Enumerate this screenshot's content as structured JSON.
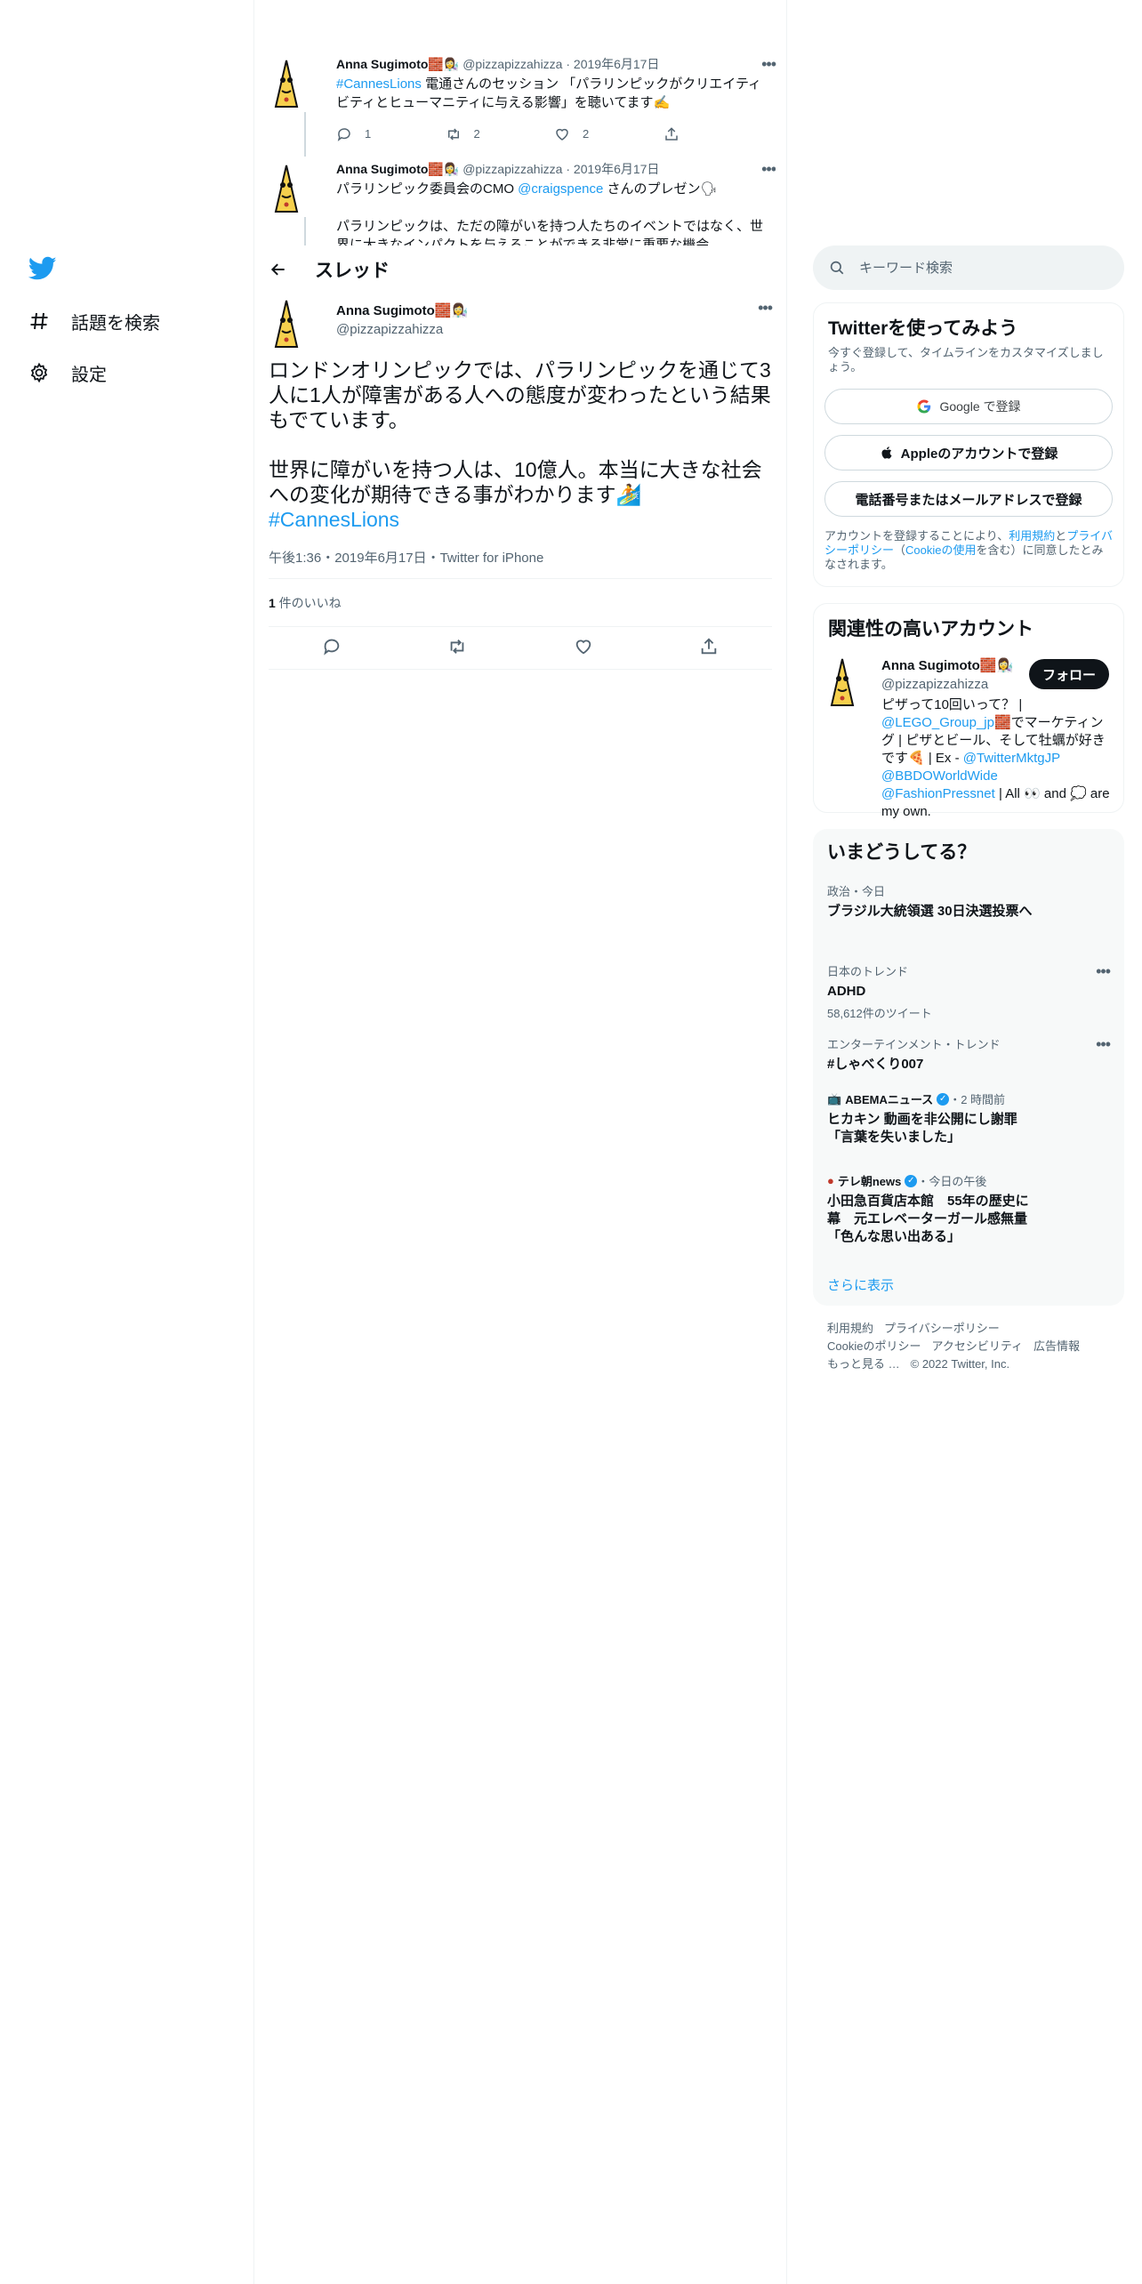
{
  "nav": {
    "explore": "話題を検索",
    "settings": "設定"
  },
  "header": {
    "title": "スレッド"
  },
  "context_tweets": [
    {
      "name": "Anna Sugimoto🧱👩‍🔬",
      "handle": "@pizzapizzahizza",
      "date": "2019年6月17日",
      "hashtag": "#CannesLions",
      "text": " 電通さんのセッション 「パラリンピックがクリエイティビティとヒューマニティに与える影響」を聴いてます✍️",
      "replies": "1",
      "retweets": "2",
      "likes": "2"
    },
    {
      "name": "Anna Sugimoto🧱👩‍🔬",
      "handle": "@pizzapizzahizza",
      "date": "2019年6月17日",
      "text_pre": "パラリンピック委員会のCMO ",
      "mention": "@craigspence",
      "text_post": " さんのプレゼン🗣",
      "text2": "パラリンピックは、ただの障がいを持つ人たちのイベントではなく、世界に大きなインパクトを与えることができる非常に重要な機会。"
    }
  ],
  "focus": {
    "name": "Anna Sugimoto🧱👩‍🔬",
    "handle": "@pizzapizzahizza",
    "text": "ロンドンオリンピックでは、パラリンピックを通じて3人に1人が障害がある人への態度が変わったという結果もでています。\n\n世界に障がいを持つ人は、10億人。本当に大きな社会への変化が期待できる事がわかります🏄",
    "hashtag": "#CannesLions",
    "meta": "午後1:36・2019年6月17日・Twitter for iPhone",
    "likes_count": "1",
    "likes_label": " 件のいいね"
  },
  "search": {
    "placeholder": "キーワード検索"
  },
  "signup": {
    "title": "Twitterを使ってみよう",
    "subtitle": "今すぐ登録して、タイムラインをカスタマイズしましょう。",
    "google": "Google で登録",
    "apple": "Appleのアカウントで登録",
    "phone": "電話番号またはメールアドレスで登録",
    "terms_1": "アカウントを登録することにより、",
    "terms_link1": "利用規約",
    "terms_2": "と",
    "terms_link2": "プライバシーポリシー",
    "terms_3": "（",
    "terms_link3": "Cookieの使用",
    "terms_4": "を含む）に同意したとみなされます。"
  },
  "related": {
    "title": "関連性の高いアカウント",
    "name": "Anna Sugimoto🧱👩‍🔬",
    "handle": "@pizzapizzahizza",
    "follow": "フォロー",
    "bio_1": "ピザって10回いって？ | ",
    "bio_link1": "@LEGO_Group_jp",
    "bio_2": "🧱でマーケティング | ピザとビール、そして牡蠣が好きです🍕 | Ex - ",
    "bio_link2": "@TwitterMktgJP",
    "bio_link3": "@BBDOWorldWide",
    "bio_link4": "@FashionPressnet",
    "bio_3": " | All 👀 and 💭 are my own."
  },
  "trends": {
    "title": "いまどうしてる？",
    "items": [
      {
        "context": "政治・今日",
        "title": "ブラジル大統領選 30日決選投票へ"
      },
      {
        "context": "日本のトレンド",
        "title": "ADHD",
        "count": "58,612件のツイート"
      },
      {
        "context": "エンターテインメント・トレンド",
        "title": "#しゃべくり007"
      },
      {
        "source": "ABEMAニュース",
        "time": "・2 時間前",
        "title": "ヒカキン 動画を非公開にし謝罪「言葉を失いました」"
      },
      {
        "source": "テレ朝news",
        "time": "・今日の午後",
        "title": "小田急百貨店本館　55年の歴史に幕　元エレベーターガール感無量「色んな思い出ある」"
      }
    ],
    "show_more": "さらに表示"
  },
  "footer": {
    "terms": "利用規約",
    "privacy": "プライバシーポリシー",
    "cookies": "Cookieのポリシー",
    "accessibility": "アクセシビリティ",
    "ads": "広告情報",
    "more": "もっと見る …",
    "copyright": "© 2022 Twitter, Inc."
  },
  "colors": {
    "accent": "#1d9bf0",
    "text": "#0f1419",
    "muted": "#536471"
  }
}
